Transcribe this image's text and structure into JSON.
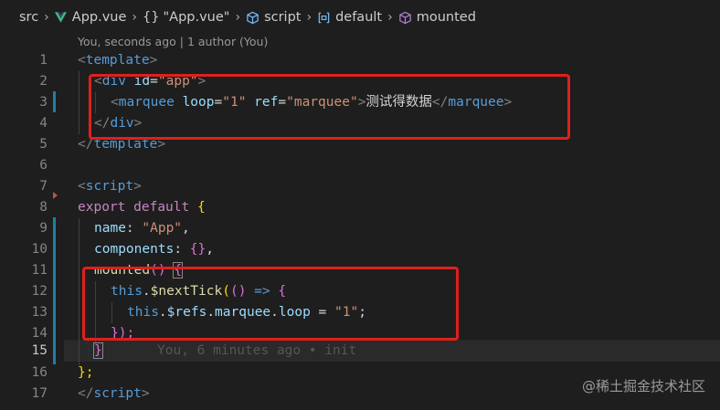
{
  "breadcrumb": {
    "items": [
      {
        "label": "src",
        "icon": ""
      },
      {
        "label": "App.vue",
        "icon": "vue-icon"
      },
      {
        "label": "\"App.vue\"",
        "icon": "braces-icon",
        "prefix": "{}"
      },
      {
        "label": "script",
        "icon": "cube-outline-icon"
      },
      {
        "label": "default",
        "icon": "module-icon"
      },
      {
        "label": "mounted",
        "icon": "method-icon"
      }
    ]
  },
  "codelens": "You, seconds ago | 1 author (You)",
  "line_numbers": [
    "1",
    "2",
    "3",
    "4",
    "5",
    "6",
    "7",
    "8",
    "9",
    "10",
    "11",
    "12",
    "13",
    "14",
    "15",
    "16",
    "17"
  ],
  "active_line": "15",
  "code": {
    "l1": {
      "tag_open": "<",
      "tag": "template",
      "tag_close": ">"
    },
    "l2": {
      "tag_open": "<",
      "tag": "div",
      "attr": "id",
      "eq": "=",
      "val": "\"app\"",
      "tag_close": ">"
    },
    "l3": {
      "tag_open": "<",
      "tag": "marquee",
      "attr1": "loop",
      "eq1": "=",
      "val1": "\"1\"",
      "attr2": "ref",
      "eq2": "=",
      "val2": "\"marquee\"",
      "gt": ">",
      "text": "测试得数据",
      "close_open": "</",
      "close_tag": "marquee",
      "close_gt": ">"
    },
    "l4": {
      "open": "</",
      "tag": "div",
      "close": ">"
    },
    "l5": {
      "open": "</",
      "tag": "template",
      "close": ">"
    },
    "l7": {
      "open": "<",
      "tag": "script",
      "close": ">"
    },
    "l8": {
      "kw1": "export",
      "kw2": "default",
      "brace": "{"
    },
    "l9": {
      "prop": "name",
      "colon": ": ",
      "val": "\"App\"",
      "comma": ","
    },
    "l10": {
      "prop": "components",
      "colon": ": ",
      "val": "{}",
      "comma": ","
    },
    "l11": {
      "fn": "mounted",
      "parens": "() ",
      "brace": "{"
    },
    "l12": {
      "this": "this",
      "dot": ".",
      "fn": "$nextTick",
      "p1": "(",
      "p2": "() ",
      "arrow": "=>",
      "brace": " {"
    },
    "l13": {
      "this": "this",
      "rest1": ".",
      "refs": "$refs",
      "dot2": ".",
      "m": "marquee",
      "dot3": ".",
      "loop": "loop",
      "eq": " = ",
      "val": "\"1\"",
      "semi": ";"
    },
    "l14": {
      "text": "});"
    },
    "l15": {
      "brace": "}"
    },
    "l16": {
      "text": "};"
    },
    "l17": {
      "open": "</",
      "tag": "script",
      "close": ">"
    }
  },
  "blame": "You, 6 minutes ago • init",
  "watermark": "@稀土掘金技术社区",
  "colors": {
    "highlight_box": "#e0201b",
    "modified_bar": "#1b81a8",
    "background": "#1e1e1e"
  }
}
